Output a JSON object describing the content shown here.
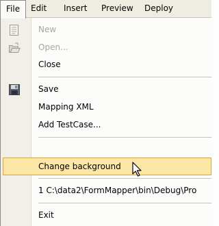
{
  "menubar": {
    "items": [
      {
        "label": "File"
      },
      {
        "label": "Edit"
      },
      {
        "label": "Insert"
      },
      {
        "label": "Preview"
      },
      {
        "label": "Deploy"
      }
    ]
  },
  "file_menu": {
    "new_label": "New",
    "open_label": "Open...",
    "close_label": "Close",
    "save_label": "Save",
    "mapping_xml_label": "Mapping XML",
    "add_testcase_label": "Add TestCase...",
    "change_background_label": "Change background",
    "recent_file_label": "1 C:\\data2\\FormMapper\\bin\\Debug\\Pro",
    "exit_label": "Exit"
  },
  "colors": {
    "menubar_bg": "#efede2",
    "highlight_bg": "#fde7a6",
    "highlight_border": "#d7a43a",
    "disabled_text": "#a8a6a0"
  }
}
